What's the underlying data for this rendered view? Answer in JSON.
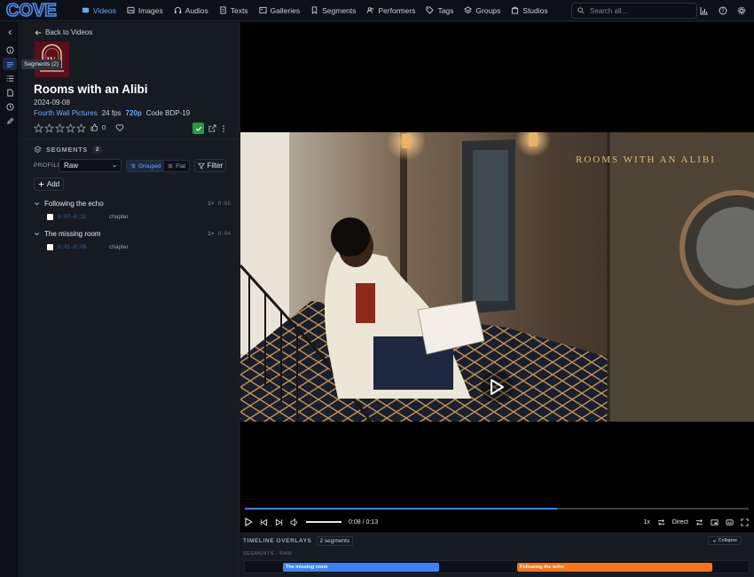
{
  "app": {
    "logo": "COVE"
  },
  "nav": [
    {
      "label": "Videos",
      "icon": "video-icon",
      "active": true
    },
    {
      "label": "Images",
      "icon": "image-icon"
    },
    {
      "label": "Audios",
      "icon": "headphones-icon"
    },
    {
      "label": "Texts",
      "icon": "text-icon"
    },
    {
      "label": "Galleries",
      "icon": "gallery-icon"
    },
    {
      "label": "Segments",
      "icon": "bookmark-icon"
    },
    {
      "label": "Performers",
      "icon": "users-icon"
    },
    {
      "label": "Tags",
      "icon": "tag-icon"
    },
    {
      "label": "Groups",
      "icon": "layers-icon"
    },
    {
      "label": "Studios",
      "icon": "studio-icon"
    }
  ],
  "search": {
    "placeholder": "Search all..."
  },
  "rail": {
    "tooltip": "Segments (2)"
  },
  "scene": {
    "back_label": "Back to Videos",
    "poster_text": "IV",
    "title": "Rooms with an Alibi",
    "date": "2024-09-08",
    "studio": "Fourth Wall Pictures",
    "fps": "24 fps",
    "resolution": "720p",
    "code": "Code BDP-19",
    "likes": "0"
  },
  "segments": {
    "heading": "SEGMENTS",
    "count": "2",
    "profile_label": "PROFILE",
    "profile_value": "Raw",
    "grouped_label": "Grouped",
    "flat_label": "Flat",
    "filter_label": "Filter",
    "add_label": "Add",
    "groups": [
      {
        "name": "Following the echo",
        "rate": "1×",
        "time": "0:05",
        "item_time": "0:07–0:12",
        "kind": "chapter"
      },
      {
        "name": "The missing room",
        "rate": "1×",
        "time": "0:04",
        "item_time": "0:01–0:05",
        "kind": "chapter"
      }
    ]
  },
  "video": {
    "overlay_text": "ROOMS WITH AN ALIBI",
    "time_display": "0:08 / 0:13",
    "progress": 0.62,
    "speed": "1x",
    "mode": "Direct"
  },
  "timeline": {
    "heading": "TIMELINE OVERLAYS",
    "count": "2 segments",
    "collapse_label": "Collapse",
    "sub_label": "SEGMENTS · RAW",
    "segments": [
      {
        "label": "The missing room",
        "color": "#3b82f6"
      },
      {
        "label": "Following the echo",
        "color": "#f97316"
      }
    ]
  },
  "colors": {
    "accent": "#6ea8fe",
    "success": "#1f9d3a",
    "segment_blue": "#3b82f6",
    "segment_orange": "#f97316"
  }
}
